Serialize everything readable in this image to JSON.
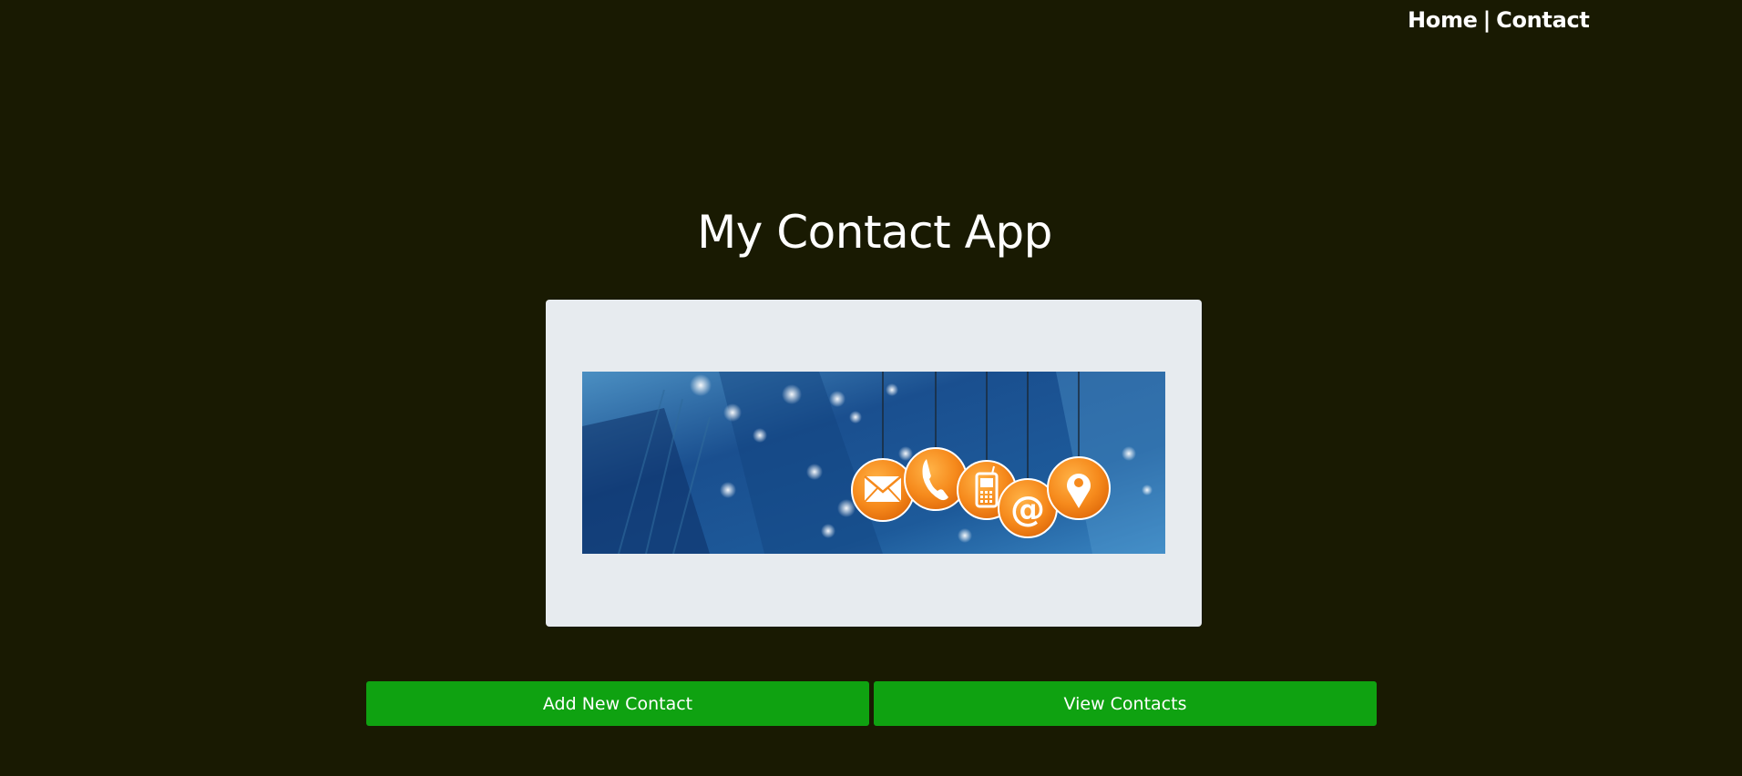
{
  "nav": {
    "home_label": "Home",
    "separator": "|",
    "contact_label": "Contact"
  },
  "header": {
    "title": "My Contact App"
  },
  "actions": {
    "add_label": "Add New Contact",
    "view_label": "View Contacts"
  },
  "banner": {
    "icons": [
      "envelope-icon",
      "phone-icon",
      "mobile-phone-icon",
      "at-sign-icon",
      "location-pin-icon"
    ]
  },
  "colors": {
    "page_background": "#191a02",
    "card_background": "#e7ebef",
    "button_green": "#0fa211",
    "icon_orange": "#f68a1c"
  }
}
